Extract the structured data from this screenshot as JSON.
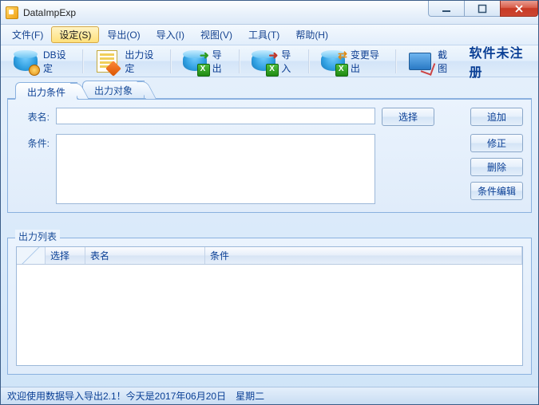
{
  "window": {
    "title": "DataImpExp"
  },
  "menu": {
    "file": "文件(F)",
    "settings": "设定(S)",
    "export": "导出(O)",
    "import": "导入(I)",
    "view": "视图(V)",
    "tools": "工具(T)",
    "help": "帮助(H)"
  },
  "toolbar": {
    "db_config": "DB设定",
    "out_config": "出力设定",
    "export": "导出",
    "import": "导入",
    "change_export": "变更导出",
    "screenshot": "截图",
    "unregistered": "软件未注册"
  },
  "tabs": {
    "cond": "出力条件",
    "target": "出力对象"
  },
  "form": {
    "table_label": "表名:",
    "table_value": "",
    "cond_label": "条件:",
    "cond_value": ""
  },
  "buttons": {
    "select": "选择",
    "add": "追加",
    "modify": "修正",
    "delete": "删除",
    "cond_edit": "条件编辑"
  },
  "list": {
    "group_label": "出力列表",
    "col_select": "选择",
    "col_table": "表名",
    "col_cond": "条件"
  },
  "status": "欢迎使用数据导入导出2.1！今天是2017年06月20日　星期二"
}
